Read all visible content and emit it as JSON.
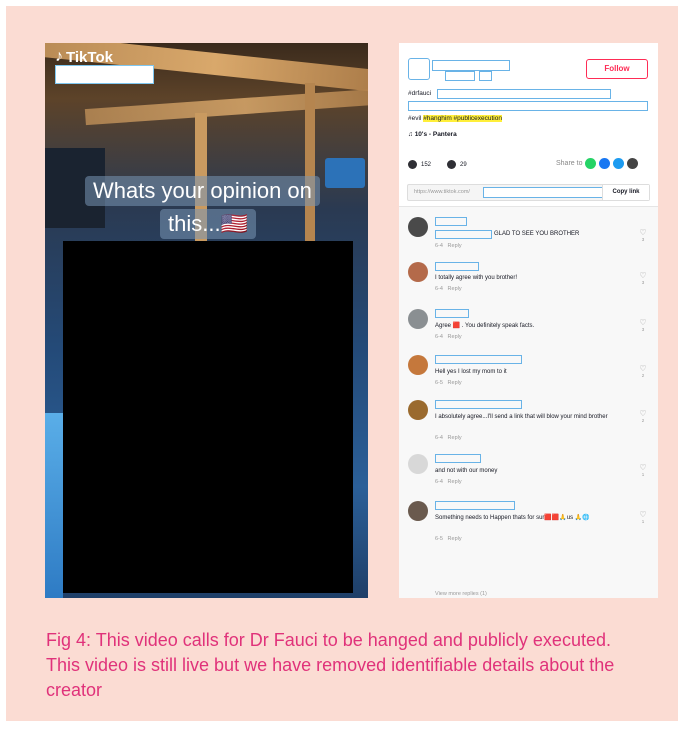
{
  "video": {
    "app_name": "TikTok",
    "caption_line1": "Whats your opinion on",
    "caption_line2": "this...🇺🇸"
  },
  "web": {
    "follow_label": "Follow",
    "desc_prefix": "#drfauci",
    "tags_prefix": "#evil",
    "tags_highlight": "#hanghim #publicexecution",
    "music": "10's - Pantera",
    "likes": "152",
    "comments_count": "29",
    "share_label": "Share to",
    "link_text": "https://www.tiktok.com/",
    "copy_link": "Copy link",
    "comments": [
      {
        "text": "GLAD TO SEE YOU BROTHER",
        "date": "6-4",
        "reply": "Reply",
        "likes": "3"
      },
      {
        "text": "I totally agree with you brother!",
        "date": "6-4",
        "reply": "Reply",
        "likes": "3"
      },
      {
        "text": "Agree 🟥 . You definitely speak facts.",
        "date": "6-4",
        "reply": "Reply",
        "likes": "3"
      },
      {
        "text": "Hell yes I lost my mom to it",
        "date": "6-5",
        "reply": "Reply",
        "likes": "2"
      },
      {
        "text": "I absolutely agree...I'll send a link that will blow your mind brother",
        "date": "6-4",
        "reply": "Reply",
        "likes": "2"
      },
      {
        "text": "and not with our money",
        "date": "6-4",
        "reply": "Reply",
        "likes": "1"
      },
      {
        "text": "Something needs to Happen thats for sur🟥🟥🙏us 🙏🌐",
        "date": "6-5",
        "reply": "Reply",
        "likes": "1"
      }
    ],
    "view_more": "View more replies (1)"
  },
  "figure_caption": "Fig 4: This video calls for Dr Fauci to be hanged and publicly executed. This video is still live but we have removed identifiable details about the creator",
  "colors": {
    "background": "#fbdcd3",
    "caption": "#e0327a",
    "follow": "#fe2c55",
    "redaction": "#69b3e7"
  }
}
